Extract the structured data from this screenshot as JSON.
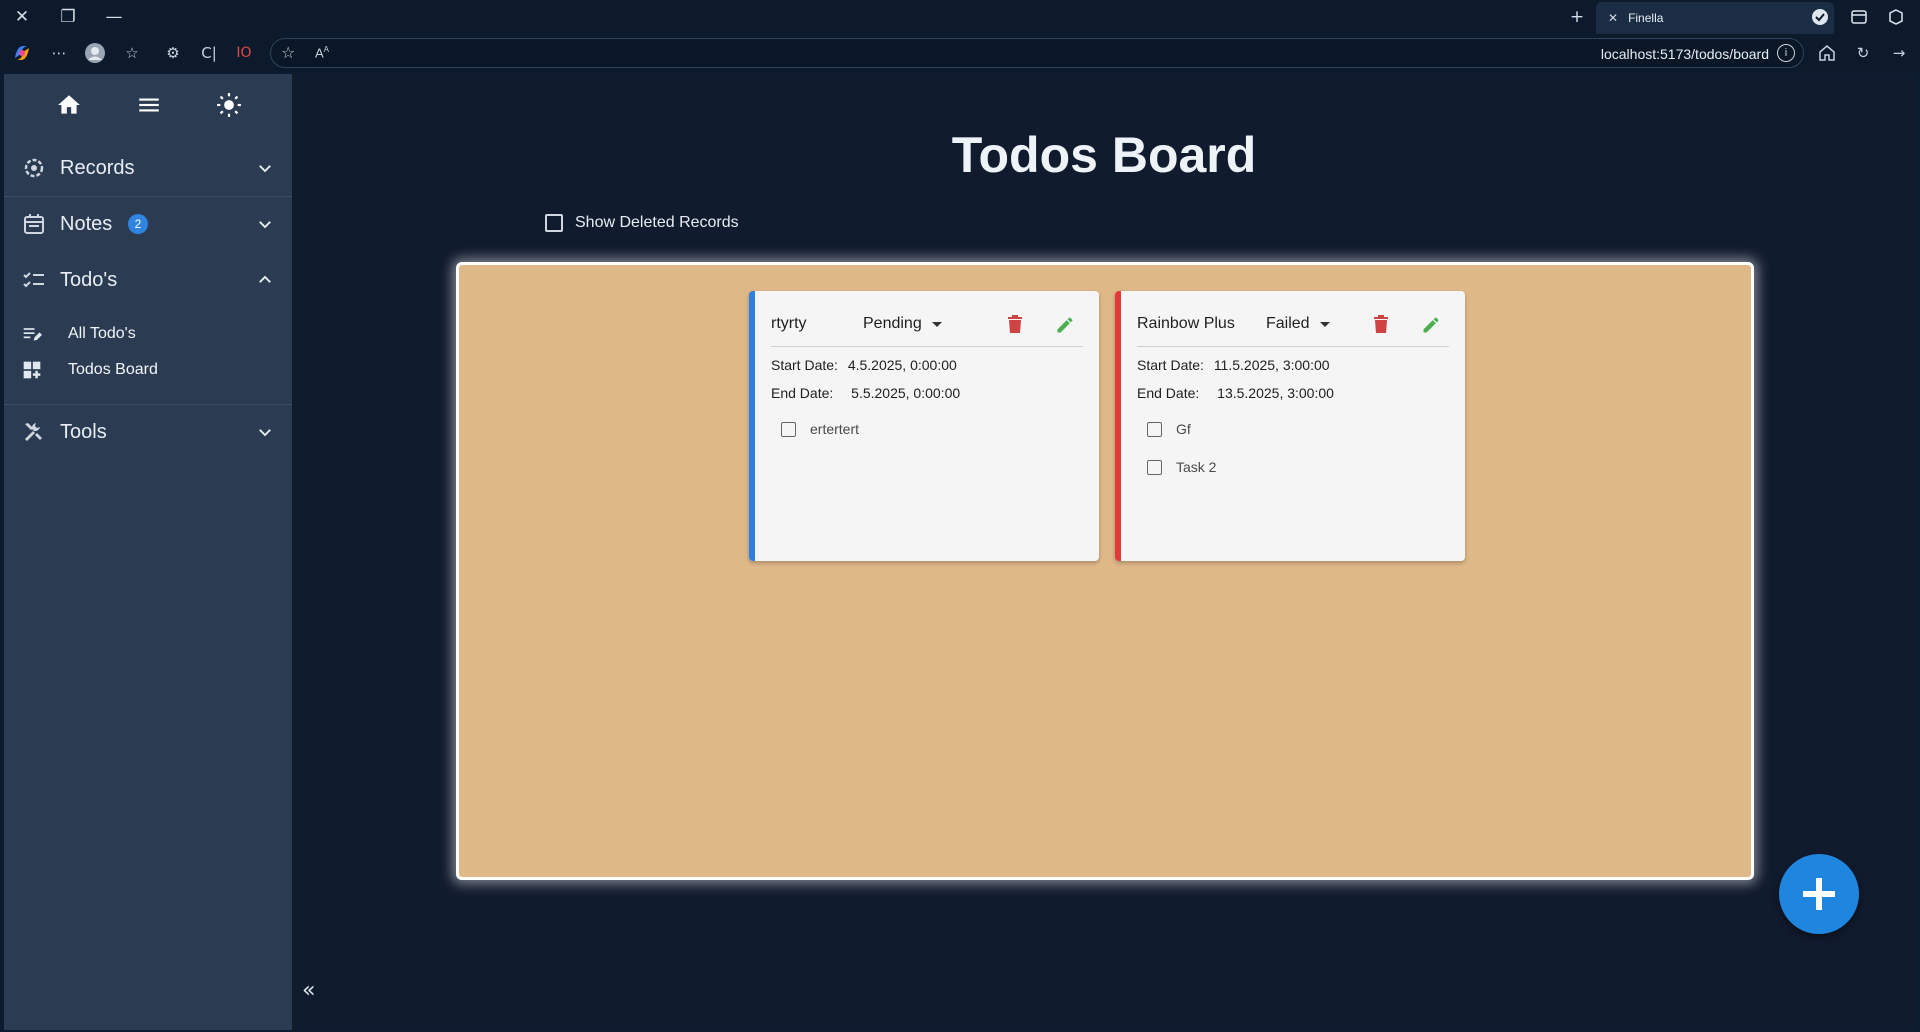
{
  "browser": {
    "tab_title": "Finella",
    "url": "localhost:5173/todos/board"
  },
  "sidebar": {
    "groups": [
      {
        "label": "Records",
        "icon": "records-icon",
        "expanded": false
      },
      {
        "label": "Notes",
        "icon": "calendar-icon",
        "badge": "2",
        "expanded": false
      },
      {
        "label": "Todo's",
        "icon": "checklist-icon",
        "expanded": true
      },
      {
        "label": "Tools",
        "icon": "tools-icon",
        "expanded": false
      }
    ],
    "sub_items": [
      {
        "label": "All Todo's",
        "icon": "edit-list-icon"
      },
      {
        "label": "Todos Board",
        "icon": "dashboard-icon"
      }
    ]
  },
  "main": {
    "title": "Todos Board",
    "show_deleted_label": "Show Deleted Records",
    "show_deleted_checked": false
  },
  "cards": [
    {
      "name": "rtyrty",
      "status": "Pending",
      "stripe_color": "#2f7fe0",
      "start_label": "Start Date:",
      "start_value": "4.5.2025, 0:00:00",
      "end_label": "End Date:",
      "end_value": "5.5.2025, 0:00:00",
      "tasks": [
        "ertertert"
      ]
    },
    {
      "name": "Rainbow Plus",
      "status": "Failed",
      "stripe_color": "#e03a3a",
      "start_label": "Start Date:",
      "start_value": "11.5.2025, 3:00:00",
      "end_label": "End Date:",
      "end_value": "13.5.2025, 3:00:00",
      "tasks": [
        "Gf",
        "Task 2"
      ]
    }
  ],
  "colors": {
    "board": "#dfb888",
    "accent": "#1f86e0",
    "delete": "#d04343",
    "edit": "#4caf50"
  }
}
